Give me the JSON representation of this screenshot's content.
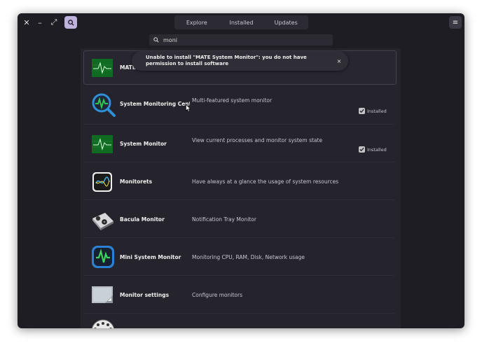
{
  "window": {
    "close_glyph": "✕",
    "minimize_glyph": "–",
    "maximize_glyph": "⤢",
    "menu_glyph": "≡"
  },
  "tabs": [
    {
      "label": "Explore"
    },
    {
      "label": "Installed"
    },
    {
      "label": "Updates"
    }
  ],
  "search": {
    "value": "moni"
  },
  "toast": {
    "message": "Unable to install \"MATE System Monitor\": you do not have permission to install software",
    "close_glyph": "×"
  },
  "apps": [
    {
      "name": "MATE System Monitor",
      "description": "",
      "installed": false,
      "icon": "mate-monitor-icon"
    },
    {
      "name": "System Monitoring Center",
      "description": "Multi-featured system monitor",
      "installed": true,
      "installed_label": "Installed",
      "icon": "system-monitoring-center-icon"
    },
    {
      "name": "System Monitor",
      "description": "View current processes and monitor system state",
      "installed": true,
      "installed_label": "Installed",
      "icon": "system-monitor-icon"
    },
    {
      "name": "Monitorets",
      "description": "Have always at a glance the usage of system resources",
      "installed": false,
      "icon": "monitorets-icon"
    },
    {
      "name": "Bacula Monitor",
      "description": "Notification Tray Monitor",
      "installed": false,
      "icon": "bacula-monitor-icon"
    },
    {
      "name": "Mini System Monitor",
      "description": "Monitoring CPU, RAM, Disk, Network usage",
      "installed": false,
      "icon": "mini-system-monitor-icon"
    },
    {
      "name": "Monitor settings",
      "description": "Configure monitors",
      "installed": false,
      "icon": "monitor-settings-icon"
    }
  ],
  "colors": {
    "window_bg": "#1f1d24",
    "content_bg": "#25232c",
    "accent": "#bfb2dd"
  }
}
